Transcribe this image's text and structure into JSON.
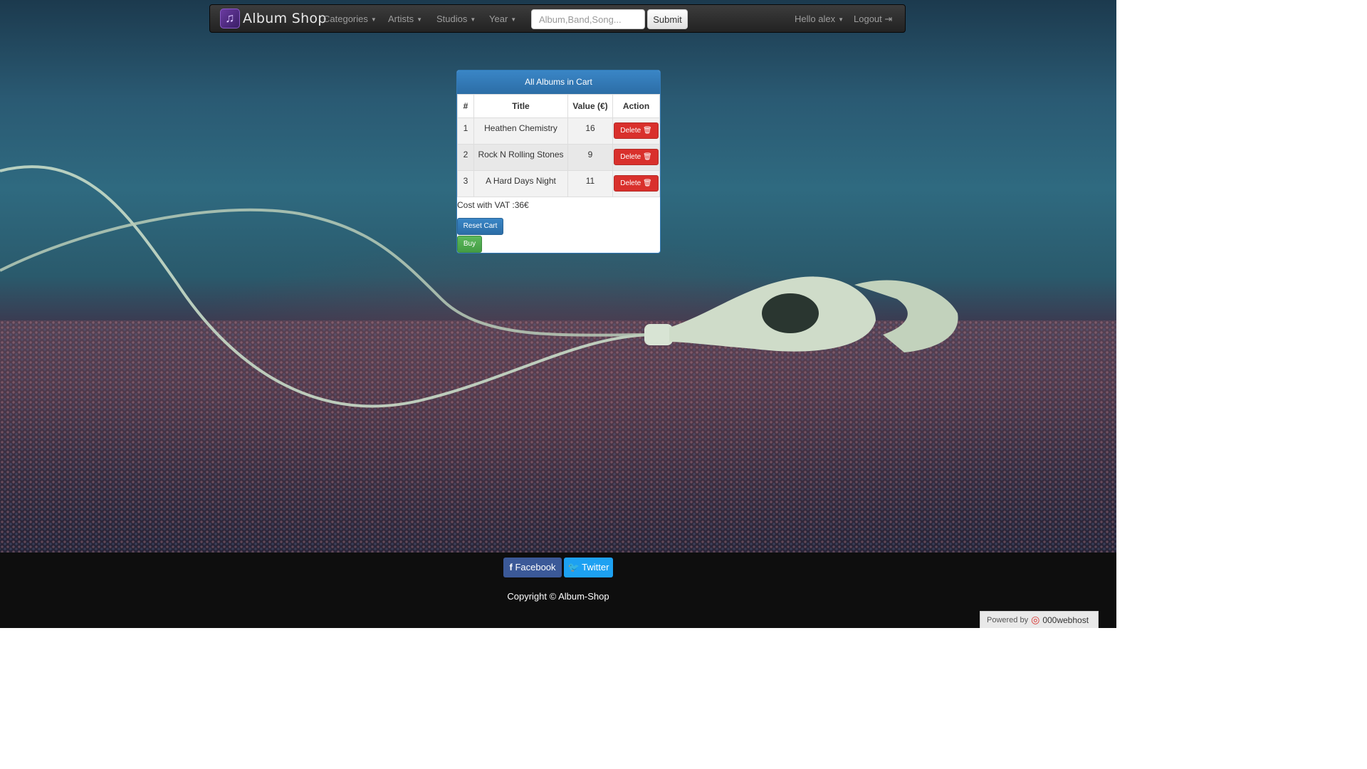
{
  "navbar": {
    "brand": "Album Shop",
    "categories": "Categories",
    "artists": "Artists",
    "studios": "Studios",
    "year": "Year",
    "search_placeholder": "Album,Band,Song...",
    "submit": "Submit",
    "user": "Hello alex",
    "logout": "Logout"
  },
  "cart": {
    "heading": "All Albums in Cart",
    "columns": [
      "#",
      "Title",
      "Value (€)",
      "Action"
    ],
    "rows": [
      {
        "num": "1",
        "title": "Heathen Chemistry",
        "value": "16",
        "action": "Delete"
      },
      {
        "num": "2",
        "title": "Rock N Rolling Stones",
        "value": "9",
        "action": "Delete"
      },
      {
        "num": "3",
        "title": "A Hard Days Night",
        "value": "11",
        "action": "Delete"
      }
    ],
    "cost": "Cost with VAT :36€",
    "reset": "Reset Cart",
    "buy": "Buy"
  },
  "footer": {
    "facebook": "Facebook",
    "twitter": "Twitter",
    "copyright": "Copyright © Album-Shop",
    "powered_by": "Powered by",
    "host": "000webhost"
  },
  "colors": {
    "accent": "#337ab7",
    "danger": "#d9302c",
    "success": "#5cb85c"
  }
}
